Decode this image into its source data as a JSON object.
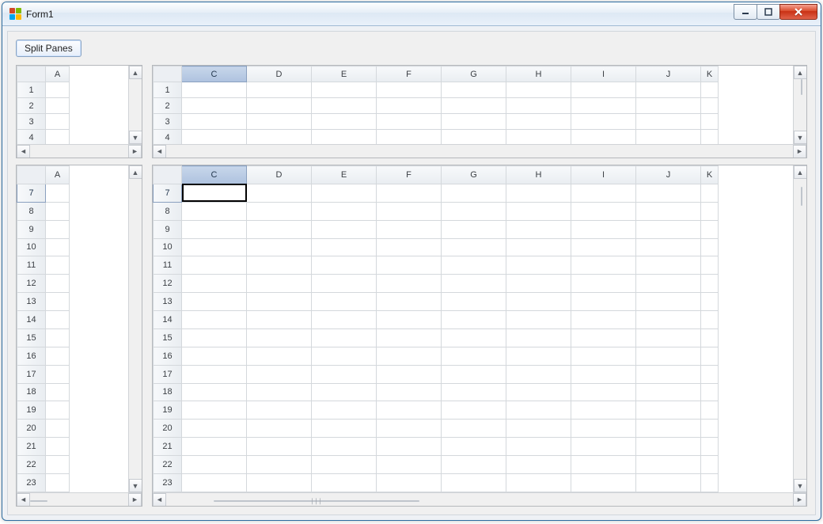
{
  "window": {
    "title": "Form1"
  },
  "toolbar": {
    "split_label": "Split Panes"
  },
  "columns_left": [
    "A"
  ],
  "columns_right": [
    "C",
    "D",
    "E",
    "F",
    "G",
    "H",
    "I",
    "J",
    "K"
  ],
  "rows_top": [
    1,
    2,
    3,
    4
  ],
  "rows_bottom": [
    7,
    8,
    9,
    10,
    11,
    12,
    13,
    14,
    15,
    16,
    17,
    18,
    19,
    20,
    21,
    22,
    23
  ],
  "selected_column": "C",
  "selected_row": 7,
  "active_cell": {
    "col": "C",
    "row": 7
  },
  "scroll_arrows": {
    "left": "◄",
    "right": "►",
    "up": "▲",
    "down": "▼"
  }
}
